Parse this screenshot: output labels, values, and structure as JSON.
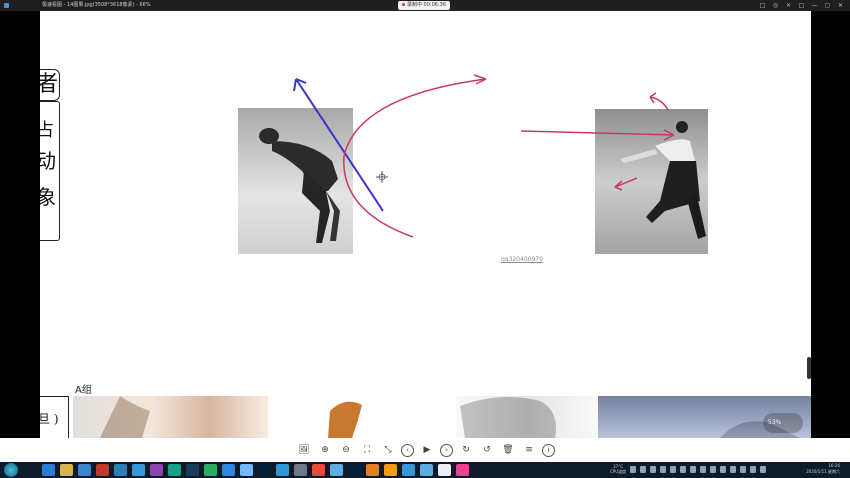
{
  "window": {
    "title": "极速看图 - 14图果.jpg(3508*3618像素) - 66%",
    "recording_label": "录制中 00:06:36",
    "controls": [
      "□",
      "◎",
      "✕",
      "□",
      "—",
      "▢",
      "✕"
    ]
  },
  "canvas": {
    "watermark": "qq320400979",
    "section_label": "A组",
    "zoom_badge": "53%",
    "sidebar_glyphs": [
      "者",
      "占",
      "动",
      "象",
      "旦"
    ]
  },
  "toolbar": {
    "buttons": [
      {
        "name": "image-icon",
        "glyph": "🖼"
      },
      {
        "name": "zoom-in-icon",
        "glyph": "⊕"
      },
      {
        "name": "zoom-out-icon",
        "glyph": "⊖"
      },
      {
        "name": "fit-screen-icon",
        "glyph": "⛶"
      },
      {
        "name": "actual-size-icon",
        "glyph": "⤡"
      },
      {
        "name": "previous-icon",
        "glyph": "‹"
      },
      {
        "name": "slideshow-icon",
        "glyph": "▶"
      },
      {
        "name": "next-icon",
        "glyph": "›"
      },
      {
        "name": "rotate-right-icon",
        "glyph": "↻"
      },
      {
        "name": "rotate-left-icon",
        "glyph": "↺"
      },
      {
        "name": "delete-icon",
        "glyph": "🗑"
      },
      {
        "name": "menu-icon",
        "glyph": "≡"
      },
      {
        "name": "info-icon",
        "glyph": "i"
      }
    ]
  },
  "taskbar": {
    "temp_label": "37°C",
    "cpu_label": "CPU温度",
    "time": "16:26",
    "date": "2020/1/11 星期六",
    "colors": {
      "bg": "#0d1b2a"
    }
  },
  "colors": {
    "blue_arrow": "#3b35c4",
    "red_arrow": "#c73a63"
  }
}
